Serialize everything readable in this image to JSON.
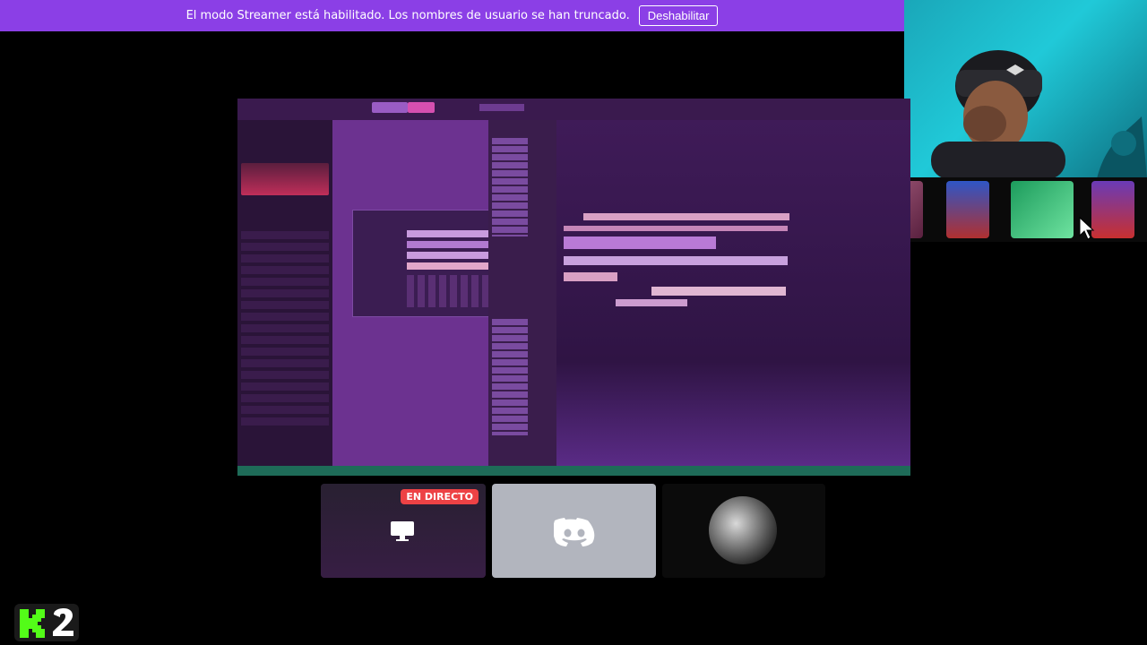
{
  "banner": {
    "message": "El modo Streamer está habilitado. Los nombres de usuario se han truncado.",
    "button_label": "Deshabilitar"
  },
  "tiles": {
    "live_badge": "EN DIRECTO"
  },
  "logo": {
    "text": "K2"
  },
  "colors": {
    "banner_bg": "#8b3fe6",
    "live_red": "#ed4245",
    "discord_tile": "#b2b5be",
    "kick_green": "#53fc18"
  }
}
